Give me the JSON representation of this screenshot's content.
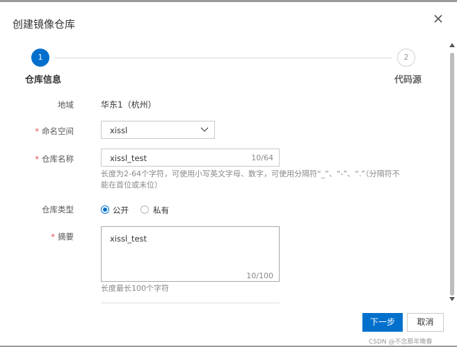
{
  "dialog": {
    "title": "创建镜像仓库"
  },
  "stepper": {
    "steps": [
      {
        "number": "1",
        "label": "仓库信息"
      },
      {
        "number": "2",
        "label": "代码源"
      }
    ]
  },
  "form": {
    "region": {
      "label": "地域",
      "value": "华东1（杭州）"
    },
    "namespace": {
      "label": "命名空间",
      "value": "xissl"
    },
    "repo_name": {
      "label": "仓库名称",
      "value": "xissl_test",
      "count": "10/64",
      "hint": "长度为2-64个字符，可使用小写英文字母、数字，可使用分隔符“_”、“-”、“.”（分隔符不能在首位或末位）"
    },
    "repo_type": {
      "label": "仓库类型",
      "options": [
        {
          "label": "公开",
          "selected": true
        },
        {
          "label": "私有",
          "selected": false
        }
      ]
    },
    "summary": {
      "label": "摘要",
      "value": "xissl_test",
      "count": "10/100",
      "hint": "长度最长100个字符"
    },
    "required_mark": "*"
  },
  "buttons": {
    "next": "下一步",
    "cancel": "取消"
  },
  "watermark": "CSDN @不念那年晚春",
  "colors": {
    "primary": "#0070cc",
    "required": "#e34d4d"
  },
  "icons": {
    "close": "close-icon",
    "dropdown": "chevron-down-icon",
    "scroll_up": "arrow-up-icon",
    "scroll_down": "arrow-down-icon"
  }
}
